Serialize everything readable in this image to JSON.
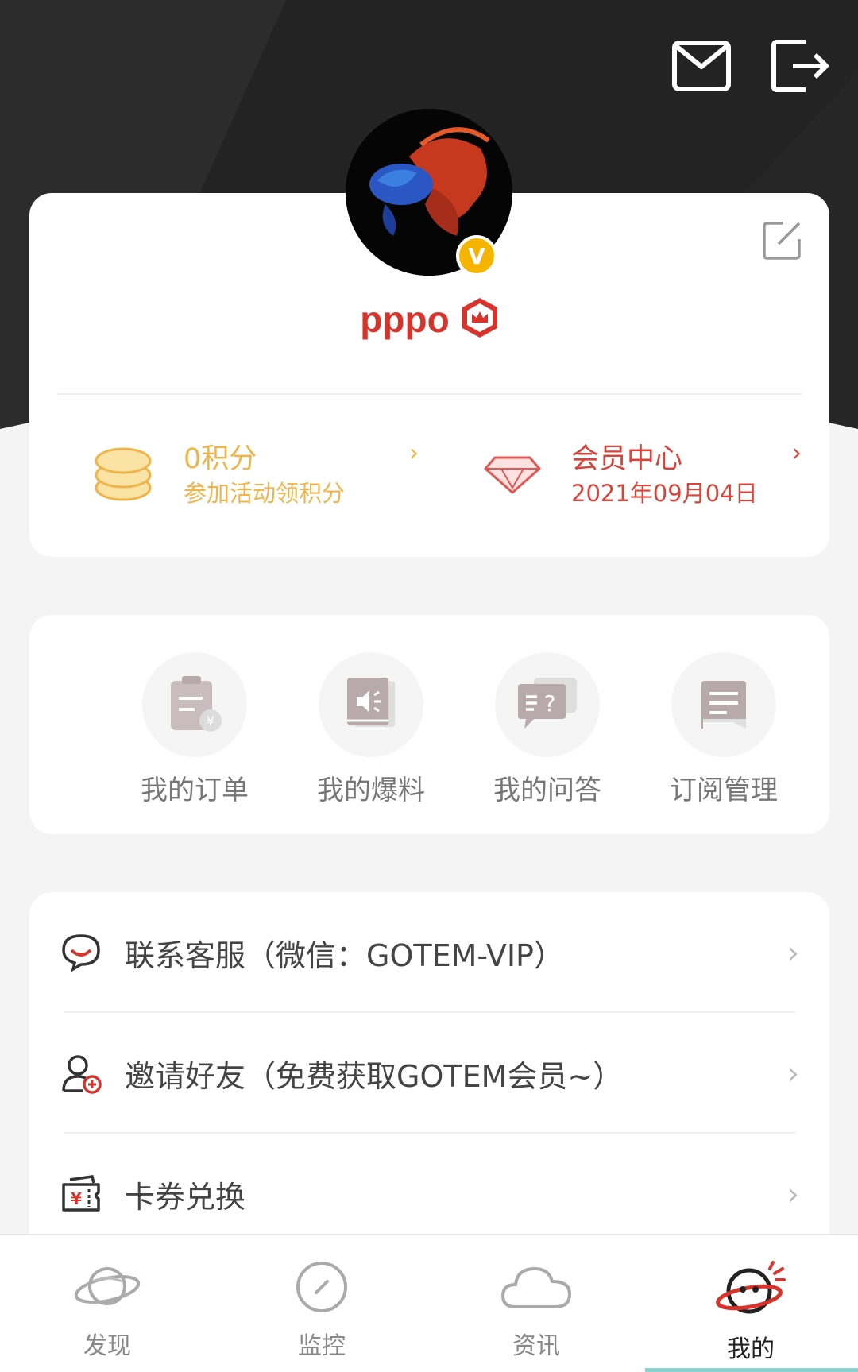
{
  "header": {
    "mail_icon": "mail-icon",
    "logout_icon": "logout-icon"
  },
  "profile": {
    "username": "pppo",
    "verified_badge": "V",
    "edit_icon": "edit-icon",
    "points": {
      "title": "0积分",
      "subtitle": "参加活动领积分",
      "arrow": "›"
    },
    "member": {
      "title": "会员中心",
      "subtitle": "2021年09月04日",
      "arrow": "›"
    }
  },
  "actions": [
    {
      "label": "我的订单",
      "icon": "order-icon"
    },
    {
      "label": "我的爆料",
      "icon": "report-icon"
    },
    {
      "label": "我的问答",
      "icon": "qa-icon"
    },
    {
      "label": "订阅管理",
      "icon": "subscription-icon"
    }
  ],
  "menu": [
    {
      "label": "联系客服（微信：GOTEM-VIP）",
      "icon": "customer-service-icon",
      "arrow": "›"
    },
    {
      "label": "邀请好友（免费获取GOTEM会员~）",
      "icon": "invite-friend-icon",
      "arrow": "›"
    },
    {
      "label": "卡券兑换",
      "icon": "coupon-icon",
      "arrow": "›"
    }
  ],
  "tabs": [
    {
      "label": "发现",
      "icon": "planet-icon",
      "active": false
    },
    {
      "label": "监控",
      "icon": "monitor-icon",
      "active": false
    },
    {
      "label": "资讯",
      "icon": "cloud-icon",
      "active": false
    },
    {
      "label": "我的",
      "icon": "profile-mascot-icon",
      "active": true
    }
  ],
  "colors": {
    "header_bg": "#262626",
    "brand_red": "#d8342c",
    "gold": "#f0b54a",
    "page_bg": "#f4f4f4"
  }
}
